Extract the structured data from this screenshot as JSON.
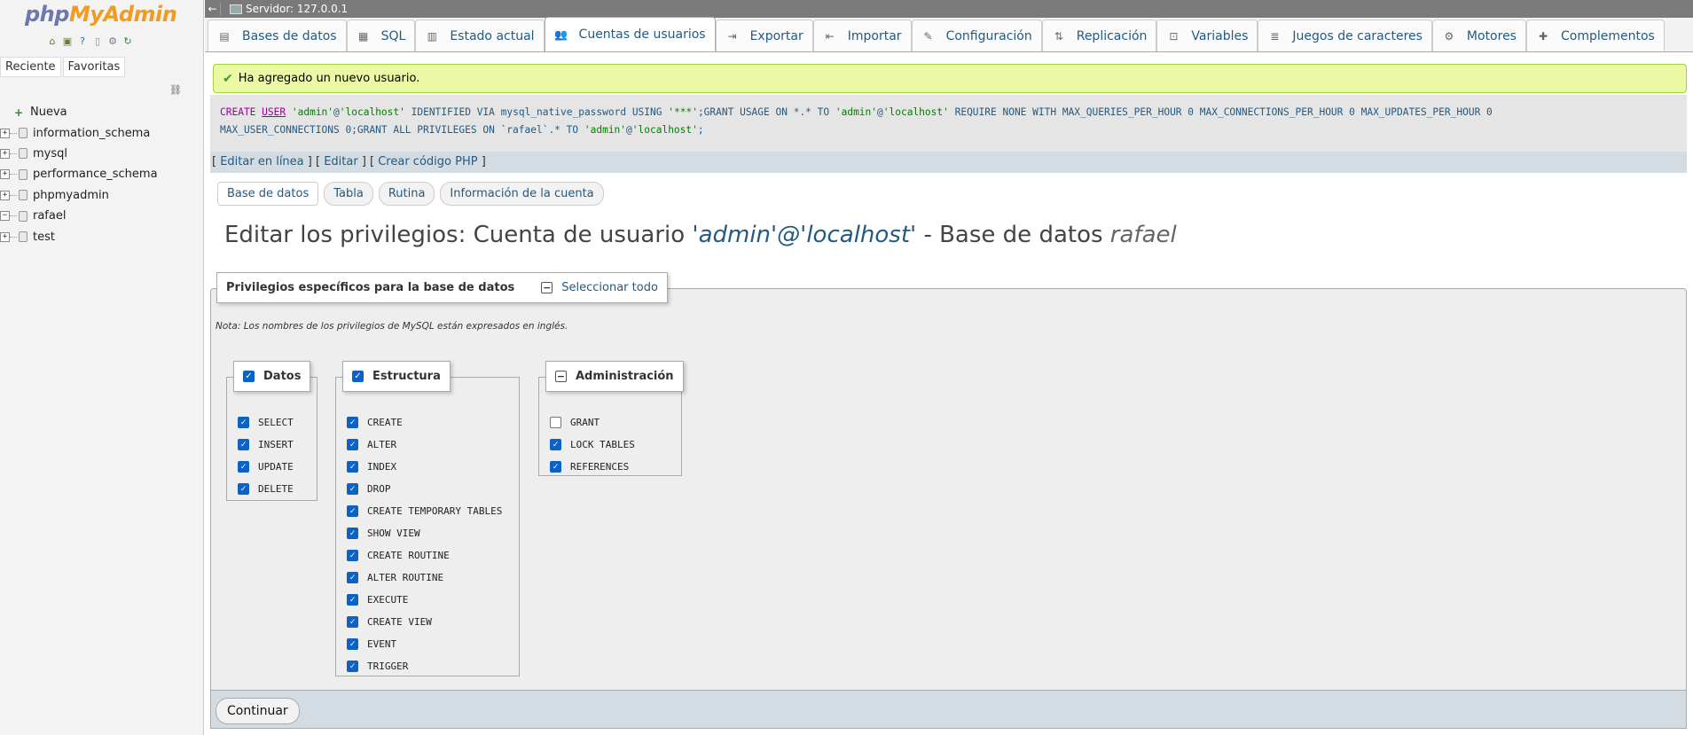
{
  "left": {
    "logo_php": "php",
    "logo_myadmin": "MyAdmin",
    "tabs": [
      "Reciente",
      "Favoritas"
    ],
    "tree": [
      {
        "label": "Nueva",
        "type": "new"
      },
      {
        "label": "information_schema",
        "type": "db",
        "expander": "+"
      },
      {
        "label": "mysql",
        "type": "db",
        "expander": "+"
      },
      {
        "label": "performance_schema",
        "type": "db",
        "expander": "+"
      },
      {
        "label": "phpmyadmin",
        "type": "db",
        "expander": "+"
      },
      {
        "label": "rafael",
        "type": "db",
        "expander": "−"
      },
      {
        "label": "test",
        "type": "db",
        "expander": "+"
      }
    ]
  },
  "topbar": {
    "server": "Servidor: 127.0.0.1"
  },
  "menu": {
    "tabs": [
      {
        "label": "Bases de datos",
        "icon": "database-icon",
        "glyph": "▤",
        "active": false
      },
      {
        "label": "SQL",
        "icon": "sql-icon",
        "glyph": "▦",
        "active": false
      },
      {
        "label": "Estado actual",
        "icon": "status-icon",
        "glyph": "▥",
        "active": false
      },
      {
        "label": "Cuentas de usuarios",
        "icon": "users-icon",
        "glyph": "👥",
        "active": true
      },
      {
        "label": "Exportar",
        "icon": "export-icon",
        "glyph": "⇥",
        "active": false
      },
      {
        "label": "Importar",
        "icon": "import-icon",
        "glyph": "⇤",
        "active": false
      },
      {
        "label": "Configuración",
        "icon": "wrench-icon",
        "glyph": "✎",
        "active": false
      },
      {
        "label": "Replicación",
        "icon": "replication-icon",
        "glyph": "⇅",
        "active": false
      },
      {
        "label": "Variables",
        "icon": "variables-icon",
        "glyph": "⊡",
        "active": false
      },
      {
        "label": "Juegos de caracteres",
        "icon": "charset-icon",
        "glyph": "≣",
        "active": false
      },
      {
        "label": "Motores",
        "icon": "engines-icon",
        "glyph": "⚙",
        "active": false
      },
      {
        "label": "Complementos",
        "icon": "plugins-icon",
        "glyph": "✚",
        "active": false
      }
    ]
  },
  "message": "Ha agregado un nuevo usuario.",
  "sql": {
    "create": "CREATE",
    "user": "USER",
    "str_user1": "'admin'",
    "at1": "@",
    "str_host1": "'localhost'",
    "mid1": " IDENTIFIED VIA mysql_native_password USING ",
    "str_pass": "'***'",
    "mid2": ";GRANT USAGE ON *.* TO ",
    "str_user2": "'admin'",
    "at2": "@",
    "str_host2": "'localhost'",
    "mid3": " REQUIRE NONE WITH MAX_QUERIES_PER_HOUR 0 MAX_CONNECTIONS_PER_HOUR 0 MAX_UPDATES_PER_HOUR 0",
    "line2a": "MAX_USER_CONNECTIONS 0;GRANT ALL PRIVILEGES ON `rafael`.* TO ",
    "str_user3": "'admin'",
    "at3": "@",
    "str_host3": "'localhost'",
    "end": ";"
  },
  "sql_links": {
    "inline": "Editar en línea",
    "edit": "Editar",
    "php": "Crear código PHP"
  },
  "subtabs": [
    "Base de datos",
    "Tabla",
    "Rutina",
    "Información de la cuenta"
  ],
  "title": {
    "prefix": "Editar los privilegios: Cuenta de usuario ",
    "account": "'admin'@'localhost'",
    "mid": " - Base de datos ",
    "db": "rafael"
  },
  "fieldset": {
    "legend": "Privilegios específicos para la base de datos",
    "select_all": "Seleccionar todo",
    "note": "Nota: Los nombres de los privilegios de MySQL están expresados en inglés."
  },
  "groups": {
    "datos": {
      "label": "Datos",
      "state": "checked",
      "privs": [
        {
          "name": "SELECT",
          "checked": true
        },
        {
          "name": "INSERT",
          "checked": true
        },
        {
          "name": "UPDATE",
          "checked": true
        },
        {
          "name": "DELETE",
          "checked": true
        }
      ]
    },
    "estructura": {
      "label": "Estructura",
      "state": "checked",
      "privs": [
        {
          "name": "CREATE",
          "checked": true
        },
        {
          "name": "ALTER",
          "checked": true
        },
        {
          "name": "INDEX",
          "checked": true
        },
        {
          "name": "DROP",
          "checked": true
        },
        {
          "name": "CREATE TEMPORARY TABLES",
          "checked": true
        },
        {
          "name": "SHOW VIEW",
          "checked": true
        },
        {
          "name": "CREATE ROUTINE",
          "checked": true
        },
        {
          "name": "ALTER ROUTINE",
          "checked": true
        },
        {
          "name": "EXECUTE",
          "checked": true
        },
        {
          "name": "CREATE VIEW",
          "checked": true
        },
        {
          "name": "EVENT",
          "checked": true
        },
        {
          "name": "TRIGGER",
          "checked": true
        }
      ]
    },
    "administracion": {
      "label": "Administración",
      "state": "indeterminate",
      "privs": [
        {
          "name": "GRANT",
          "checked": false
        },
        {
          "name": "LOCK TABLES",
          "checked": true
        },
        {
          "name": "REFERENCES",
          "checked": true
        }
      ]
    }
  },
  "button": {
    "continue": "Continuar"
  },
  "colors": {
    "link": "#235a81",
    "checkbox": "#0b62c4",
    "success_bg": "#ebf8a4"
  }
}
